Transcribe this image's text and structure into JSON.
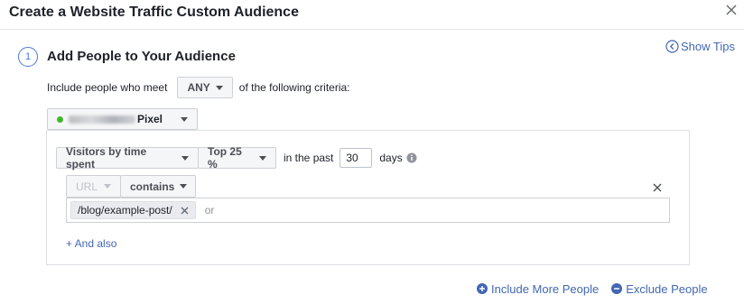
{
  "header": {
    "title": "Create a Website Traffic Custom Audience"
  },
  "show_tips": {
    "label": "Show Tips"
  },
  "step": {
    "number": "1",
    "title": "Add People to Your Audience"
  },
  "criteria": {
    "prefix": "Include people who meet",
    "match_value": "ANY",
    "suffix": "of the following criteria:"
  },
  "pixel": {
    "label": "Pixel",
    "status_color": "#42b72a"
  },
  "rule": {
    "type_value": "Visitors by time spent",
    "percentile_value": "Top 25 %",
    "in_the_past_label": "in the past",
    "days_value": "30",
    "days_label": "days",
    "field_value": "URL",
    "operator_value": "contains",
    "tokens": [
      "/blog/example-post/"
    ],
    "or_placeholder": "or",
    "and_also_label": "+ And also"
  },
  "footer": {
    "include_more_label": "Include More People",
    "exclude_label": "Exclude People"
  },
  "colors": {
    "link": "#4267b2",
    "step_accent": "#4a7ad1"
  }
}
